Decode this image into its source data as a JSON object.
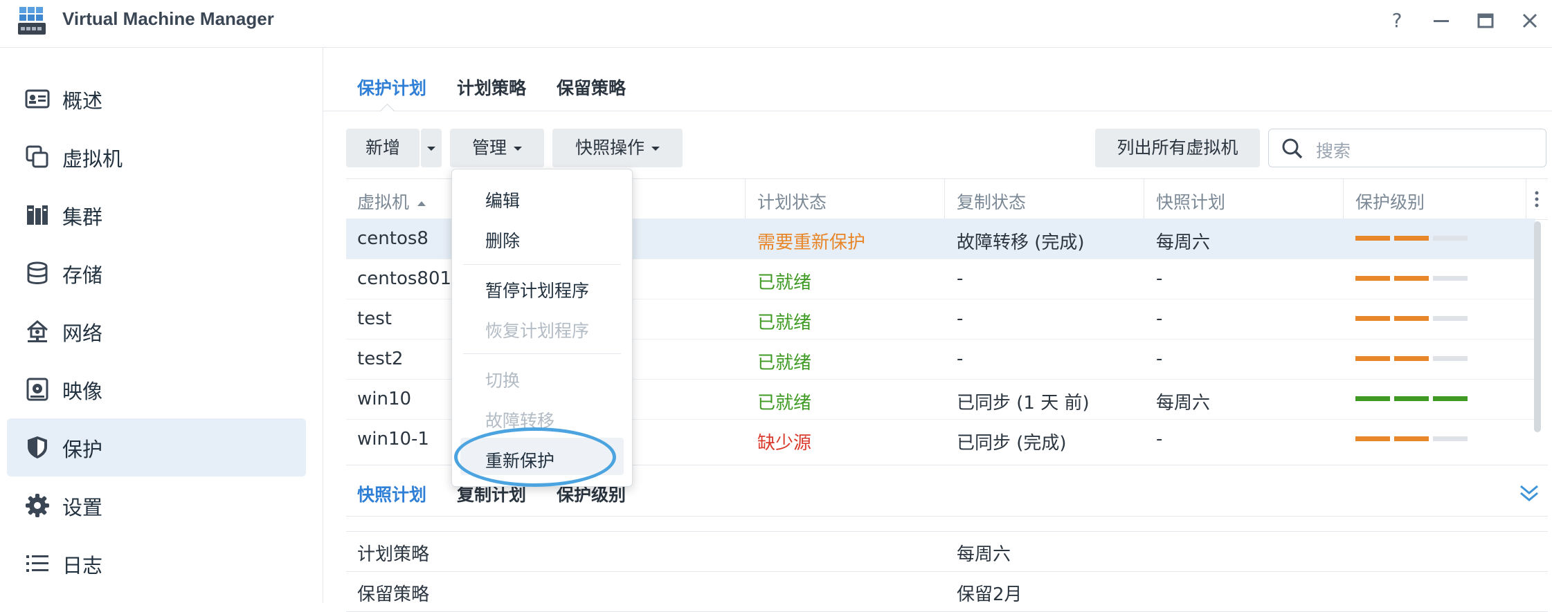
{
  "app": {
    "title": "Virtual Machine Manager",
    "window_buttons": [
      "?",
      "—",
      "▭",
      "✕"
    ]
  },
  "sidebar": {
    "items": [
      {
        "label": "概述",
        "icon": "overview-card-icon"
      },
      {
        "label": "虚拟机",
        "icon": "vm-copy-icon"
      },
      {
        "label": "集群",
        "icon": "cluster-icon"
      },
      {
        "label": "存储",
        "icon": "storage-database-icon"
      },
      {
        "label": "网络",
        "icon": "network-icon"
      },
      {
        "label": "映像",
        "icon": "image-disk-icon"
      },
      {
        "label": "保护",
        "icon": "shield-icon",
        "active": true
      },
      {
        "label": "设置",
        "icon": "gear-icon"
      },
      {
        "label": "日志",
        "icon": "list-icon"
      }
    ]
  },
  "tabs": [
    "保护计划",
    "计划策略",
    "保留策略"
  ],
  "toolbar": {
    "add_label": "新增",
    "manage_label": "管理",
    "snapshot_label": "快照操作",
    "list_all_label": "列出所有虚拟机",
    "search_placeholder": "搜索"
  },
  "table": {
    "headers": [
      "虚拟机",
      "计划状态",
      "复制状态",
      "快照计划",
      "保护级别"
    ],
    "rows": [
      {
        "vm": "centos8",
        "plan_status": "需要重新保护",
        "status_color": "#e8862a",
        "replication": "故障转移 (完成)",
        "snapshot": "每周六",
        "level": "orange"
      },
      {
        "vm": "centos801",
        "plan_status": "已就绪",
        "status_color": "#3f9a23",
        "replication": "-",
        "snapshot": "-",
        "level": "orange"
      },
      {
        "vm": "test",
        "plan_status": "已就绪",
        "status_color": "#3f9a23",
        "replication": "-",
        "snapshot": "-",
        "level": "orange"
      },
      {
        "vm": "test2",
        "plan_status": "已就绪",
        "status_color": "#3f9a23",
        "replication": "-",
        "snapshot": "-",
        "level": "orange"
      },
      {
        "vm": "win10",
        "plan_status": "已就绪",
        "status_color": "#3f9a23",
        "replication": "已同步 (1 天 前)",
        "snapshot": "每周六",
        "level": "green"
      },
      {
        "vm": "win10-1",
        "plan_status": "缺少源",
        "status_color": "#d93a2b",
        "replication": "已同步 (完成)",
        "snapshot": "-",
        "level": "orange"
      }
    ]
  },
  "manage_menu": {
    "items": [
      {
        "label": "编辑",
        "disabled": false
      },
      {
        "label": "删除",
        "disabled": false
      },
      {
        "label": "暂停计划程序",
        "disabled": false
      },
      {
        "label": "恢复计划程序",
        "disabled": true
      },
      {
        "label": "切换",
        "disabled": true
      },
      {
        "label": "故障转移",
        "disabled": true
      },
      {
        "label": "重新保护",
        "disabled": false
      }
    ]
  },
  "bottom": {
    "tabs": [
      "快照计划",
      "复制计划",
      "保护级别"
    ],
    "details": [
      {
        "key": "计划策略",
        "value": "每周六"
      },
      {
        "key": "保留策略",
        "value": "保留2月"
      }
    ]
  },
  "colors": {
    "accent": "#2f7fd6",
    "orange": "#e8862a",
    "green": "#3f9a23",
    "red": "#d93a2b",
    "highlight_ring": "#4ba3e0"
  }
}
